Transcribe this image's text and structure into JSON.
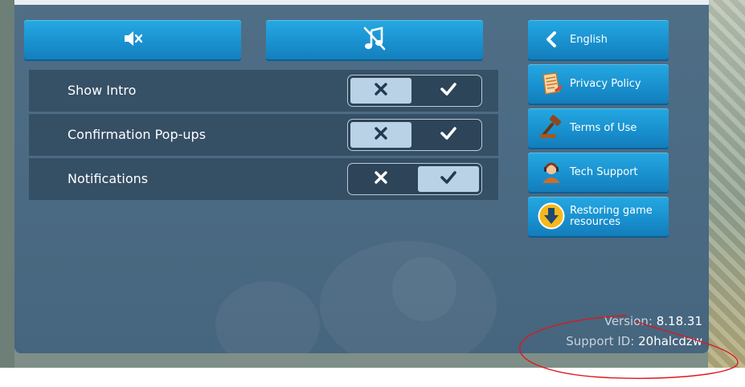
{
  "sound": {
    "sfx_icon": "speaker-muted-icon",
    "music_icon": "music-muted-icon"
  },
  "settings": [
    {
      "label": "Show Intro",
      "value": false
    },
    {
      "label": "Confirmation Pop-ups",
      "value": false
    },
    {
      "label": "Notifications",
      "value": true
    }
  ],
  "side_menu": {
    "language": {
      "label": "English",
      "icon": "chevron-left-icon"
    },
    "privacy": {
      "label": "Privacy Policy",
      "icon": "document-icon"
    },
    "terms": {
      "label": "Terms of Use",
      "icon": "gavel-icon"
    },
    "support": {
      "label": "Tech Support",
      "icon": "support-agent-icon"
    },
    "restore": {
      "label": "Restoring game resources",
      "icon": "download-icon"
    }
  },
  "footer": {
    "version_label": "Version:",
    "version_value": "8.18.31",
    "support_label": "Support ID:",
    "support_value": "20halcdzw"
  },
  "colors": {
    "button_blue": "#1a92d0",
    "panel": "#4a6982",
    "toggle_active": "#b9d2e6",
    "annotation_red": "#e0161b"
  }
}
